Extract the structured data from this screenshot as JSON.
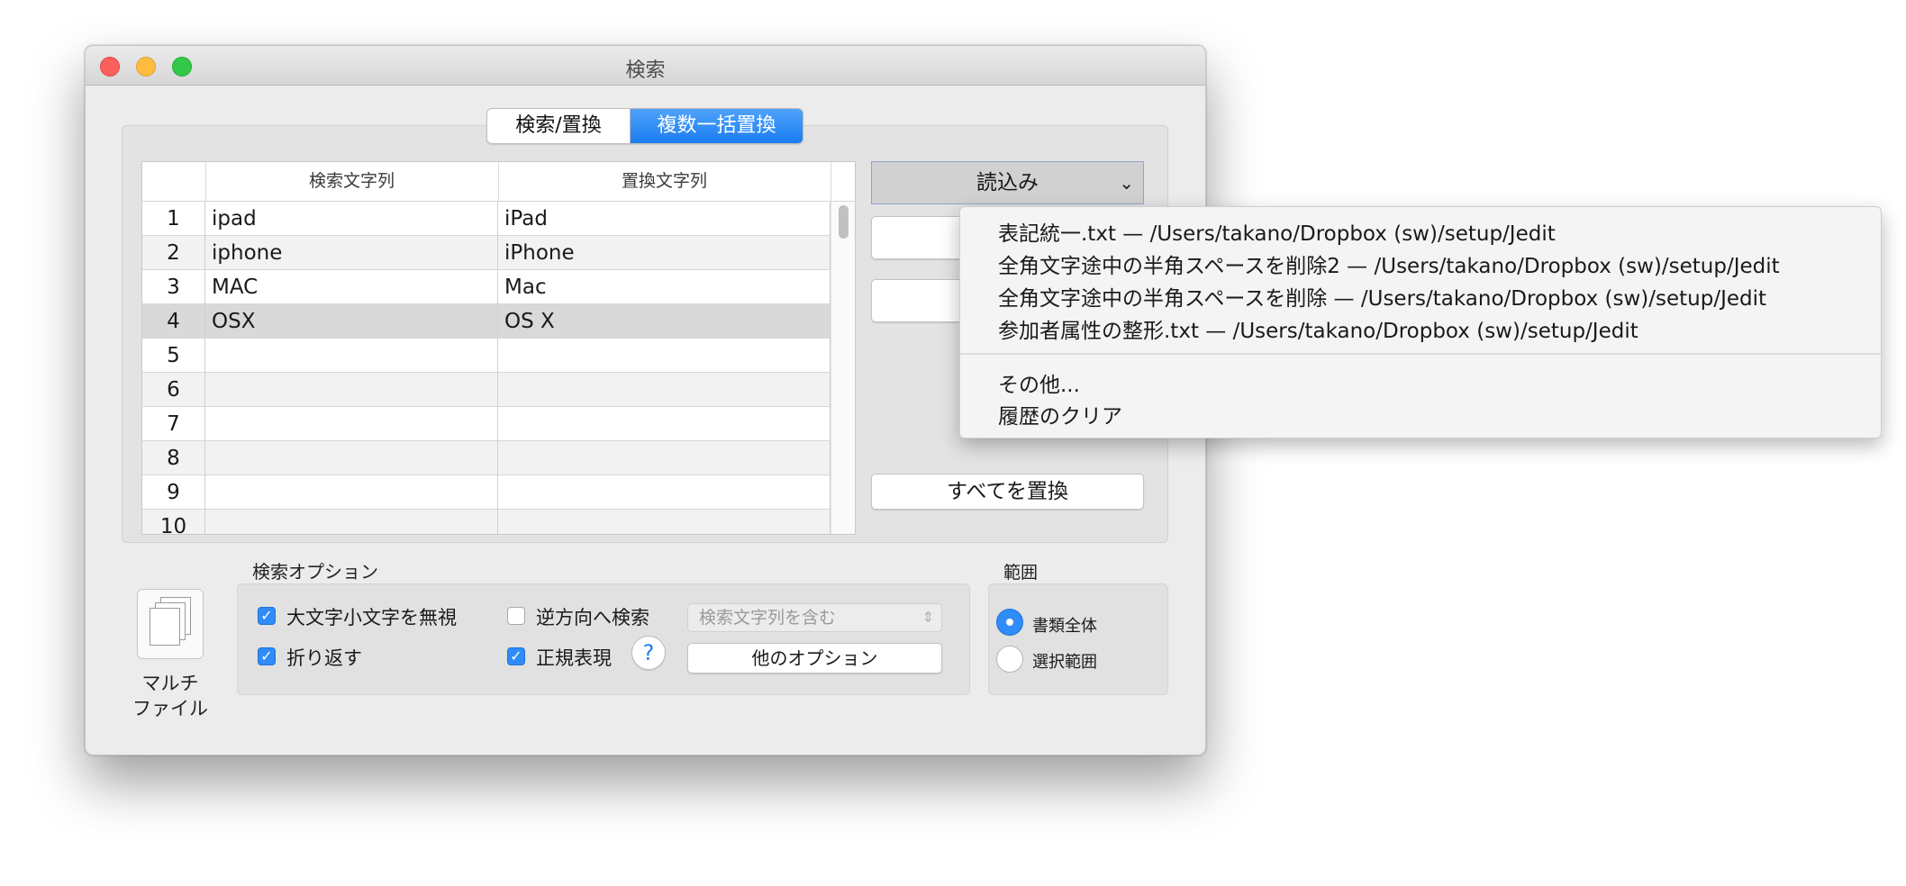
{
  "window": {
    "title": "検索",
    "tabs": [
      {
        "label": "検索/置換",
        "selected": false
      },
      {
        "label": "複数一括置換",
        "selected": true
      }
    ]
  },
  "table": {
    "headers": {
      "search": "検索文字列",
      "replace": "置換文字列"
    },
    "rows": [
      {
        "no": "1",
        "search": "ipad",
        "replace": "iPad"
      },
      {
        "no": "2",
        "search": "iphone",
        "replace": "iPhone"
      },
      {
        "no": "3",
        "search": "MAC",
        "replace": "Mac"
      },
      {
        "no": "4",
        "search": "OSX",
        "replace": "OS X"
      },
      {
        "no": "5",
        "search": "",
        "replace": ""
      },
      {
        "no": "6",
        "search": "",
        "replace": ""
      },
      {
        "no": "7",
        "search": "",
        "replace": ""
      },
      {
        "no": "8",
        "search": "",
        "replace": ""
      },
      {
        "no": "9",
        "search": "",
        "replace": ""
      },
      {
        "no": "10",
        "search": "",
        "replace": ""
      }
    ],
    "selected_row": "4"
  },
  "actions": {
    "load_label": "読込み",
    "replace_all_label": "すべてを置換"
  },
  "load_menu": {
    "recent": [
      "表記統一.txt  —  /Users/takano/Dropbox (sw)/setup/Jedit",
      "全角文字途中の半角スペースを削除2  —  /Users/takano/Dropbox (sw)/setup/Jedit",
      "全角文字途中の半角スペースを削除  —  /Users/takano/Dropbox (sw)/setup/Jedit",
      "参加者属性の整形.txt  —  /Users/takano/Dropbox (sw)/setup/Jedit"
    ],
    "other": "その他...",
    "clear": "履歴のクリア"
  },
  "multi_file": {
    "line1": "マルチ",
    "line2": "ファイル"
  },
  "options": {
    "group_label": "検索オプション",
    "ignore_case": {
      "label": "大文字小文字を無視",
      "checked": true
    },
    "wrap": {
      "label": "折り返す",
      "checked": true
    },
    "reverse": {
      "label": "逆方向へ検索",
      "checked": false
    },
    "regex": {
      "label": "正規表現",
      "checked": true
    },
    "help": "?",
    "match_mode": "検索文字列を含む",
    "more_options": "他のオプション"
  },
  "scope": {
    "group_label": "範囲",
    "whole_document": {
      "label": "書類全体",
      "selected": true
    },
    "selection": {
      "label": "選択範囲",
      "selected": false
    }
  }
}
